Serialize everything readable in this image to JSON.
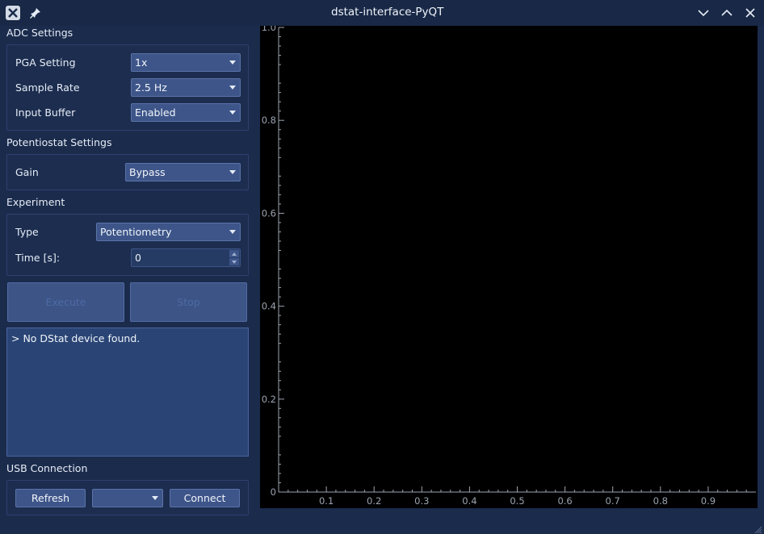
{
  "window": {
    "title": "dstat-interface-PyQT"
  },
  "adc": {
    "title": "ADC Settings",
    "pga_label": "PGA Setting",
    "pga_value": "1x",
    "rate_label": "Sample Rate",
    "rate_value": "2.5 Hz",
    "buffer_label": "Input Buffer",
    "buffer_value": "Enabled"
  },
  "potentiostat": {
    "title": "Potentiostat Settings",
    "gain_label": "Gain",
    "gain_value": "Bypass"
  },
  "experiment": {
    "title": "Experiment",
    "type_label": "Type",
    "type_value": "Potentiometry",
    "time_label": "Time [s]:",
    "time_value": "0"
  },
  "actions": {
    "execute_label": "Execute",
    "stop_label": "Stop"
  },
  "log": {
    "text": "> No DStat device found."
  },
  "usb": {
    "title": "USB Connection",
    "refresh_label": "Refresh",
    "port_value": "",
    "connect_label": "Connect"
  },
  "icons": [
    "close-app-icon",
    "pin-icon",
    "minimize-icon",
    "maximize-icon",
    "close-window-icon",
    "resize-grip-icon"
  ],
  "colors": {
    "background": "#1b2b4c",
    "plot_bg": "#000000",
    "button": "#3d5589",
    "axis": "#9ba3b0"
  },
  "chart_data": {
    "type": "line",
    "title": "",
    "xlabel": "",
    "ylabel": "",
    "series": [],
    "xlim": [
      0,
      1
    ],
    "ylim": [
      0,
      1
    ],
    "x_ticks": [
      "0.1",
      "0.2",
      "0.3",
      "0.4",
      "0.5",
      "0.6",
      "0.7",
      "0.8",
      "0.9"
    ],
    "y_ticks": [
      "0",
      "0.2",
      "0.4",
      "0.6",
      "0.8",
      "1.0"
    ],
    "grid": false
  }
}
